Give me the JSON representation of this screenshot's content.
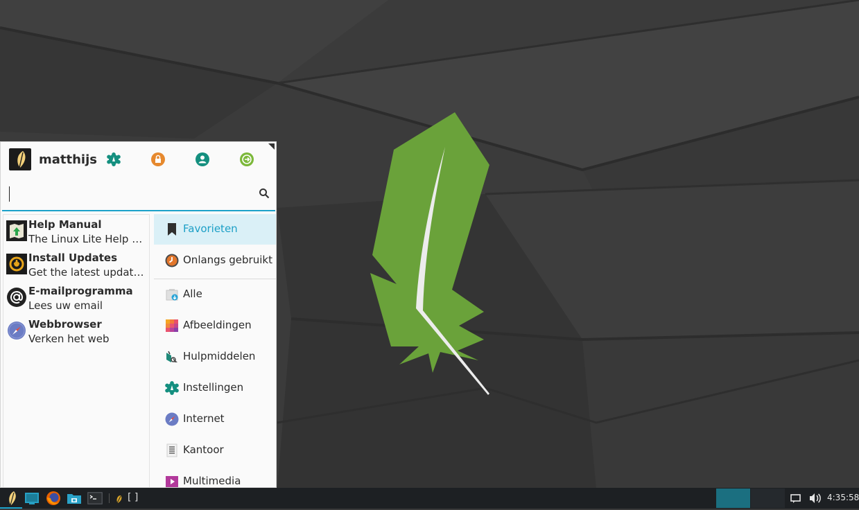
{
  "user": {
    "name": "matthijs"
  },
  "header_icons": [
    "settings-icon",
    "lock-icon",
    "user-icon",
    "logout-icon"
  ],
  "search": {
    "value": "",
    "placeholder": ""
  },
  "favorites": [
    {
      "title": "Help Manual",
      "description": "The Linux Lite Help & Support",
      "icon": "help-manual-icon"
    },
    {
      "title": "Install Updates",
      "description": "Get the latest updates for your system",
      "icon": "install-updates-icon"
    },
    {
      "title": "E-mailprogramma",
      "description": "Lees uw email",
      "icon": "email-icon"
    },
    {
      "title": "Webbrowser",
      "description": "Verken het web",
      "icon": "web-browser-icon"
    }
  ],
  "categories": [
    {
      "label": "Favorieten",
      "icon": "bookmark-icon",
      "active": true
    },
    {
      "label": "Onlangs gebruikt",
      "icon": "recent-icon",
      "active": false
    },
    {
      "label": "Alle",
      "icon": "all-apps-icon",
      "active": false
    },
    {
      "label": "Afbeeldingen",
      "icon": "graphics-icon",
      "active": false
    },
    {
      "label": "Hulpmiddelen",
      "icon": "accessories-icon",
      "active": false
    },
    {
      "label": "Instellingen",
      "icon": "settings-icon",
      "active": false
    },
    {
      "label": "Internet",
      "icon": "internet-icon",
      "active": false
    },
    {
      "label": "Kantoor",
      "icon": "office-icon",
      "active": false
    },
    {
      "label": "Multimedia",
      "icon": "multimedia-icon",
      "active": false
    }
  ],
  "taskbar": {
    "launchers": [
      "whisker-menu-icon",
      "desktop-icon",
      "firefox-icon",
      "file-manager-icon",
      "terminal-icon"
    ],
    "task_label": "[ ]",
    "workspaces": 2,
    "active_workspace": 1,
    "clock": "4:35:58"
  },
  "colors": {
    "accent": "#1ba1c9",
    "feather": "#6aa23a",
    "panel": "#1d2023"
  }
}
